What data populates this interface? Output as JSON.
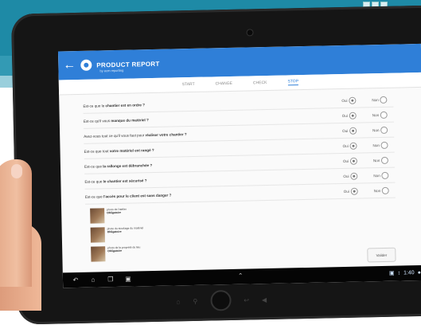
{
  "app": {
    "title": "PRODUCT REPORT",
    "subtitle": "by ecm reporting",
    "back_icon": "arrow-left-icon",
    "logo_icon": "logo-icon"
  },
  "tabs": [
    {
      "label": "START",
      "active": false
    },
    {
      "label": "CHANGE",
      "active": false
    },
    {
      "label": "CHECK",
      "active": false
    },
    {
      "label": "STOP",
      "active": true
    }
  ],
  "questions": [
    {
      "pre": "Est-ce que le ",
      "bold": "chantier est en ordre ?",
      "answer": "Oui"
    },
    {
      "pre": "Est-ce qu'il vous ",
      "bold": "manque du matériel ?",
      "answer": "Oui"
    },
    {
      "pre": "Avez-vous tout ce qu'il vous faut pour ",
      "bold": "réaliser votre chantier ?",
      "answer": "Oui"
    },
    {
      "pre": "Est-ce que tout ",
      "bold": "votre matériel est rangé ?",
      "answer": "Oui"
    },
    {
      "pre": "Est-ce que ",
      "bold": "la rallonge est débranchée ?",
      "answer": "Oui"
    },
    {
      "pre": "Est-ce que ",
      "bold": "le chantier est sécurisé ?",
      "answer": "Oui"
    },
    {
      "pre": "Est-ce que ",
      "bold": "l'accès pour le client est sans danger ?",
      "answer": "Oui"
    }
  ],
  "options": {
    "yes": "Oui",
    "no": "Non"
  },
  "photos": [
    {
      "title": "photo de l'atelier",
      "sub": "Obligatoire"
    },
    {
      "title": "photo du stockage du matériel",
      "sub": "Obligatoire"
    },
    {
      "title": "photo de la propreté du lieu",
      "sub": "Obligatoire"
    }
  ],
  "send_label": "Valider",
  "status_bar": {
    "time": "1:40"
  },
  "colors": {
    "accent": "#2f7fd8",
    "background_teal": "#1e8aa6"
  }
}
